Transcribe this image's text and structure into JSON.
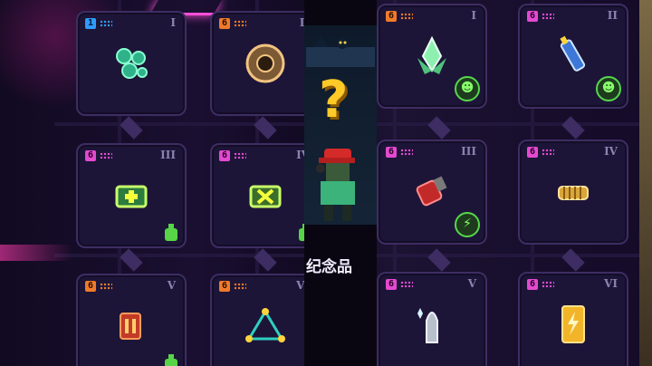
{
  "screen": {
    "label": "纪念品"
  },
  "colors": {
    "accent": "#ff4fd8",
    "badge_green": "#56d64b",
    "panel": "#1d1538"
  },
  "left_cards": [
    {
      "tier": "1",
      "roman": "I",
      "item": "cell-cluster-icon",
      "tier_color": "blue"
    },
    {
      "tier": "6",
      "roman": "II",
      "item": "barrel-icon",
      "tier_color": "orange"
    },
    {
      "tier": "6",
      "roman": "III",
      "item": "medkit-icon",
      "tier_color": "pink"
    },
    {
      "tier": "6",
      "roman": "IV",
      "item": "cross-bag-icon",
      "tier_color": "pink"
    },
    {
      "tier": "6",
      "roman": "V",
      "item": "explosive-vest-icon",
      "tier_color": "orange"
    },
    {
      "tier": "6",
      "roman": "VI",
      "item": "triangle-gadget-icon",
      "tier_color": "orange"
    }
  ],
  "right_cards": [
    {
      "tier": "6",
      "roman": "I",
      "item": "crystal-flower-icon",
      "tier_color": "orange"
    },
    {
      "tier": "6",
      "roman": "II",
      "item": "syringe-icon",
      "tier_color": "pink"
    },
    {
      "tier": "6",
      "roman": "III",
      "item": "red-gauntlet-icon",
      "tier_color": "pink"
    },
    {
      "tier": "6",
      "roman": "IV",
      "item": "coin-stack-icon",
      "tier_color": "pink"
    },
    {
      "tier": "6",
      "roman": "V",
      "item": "bullet-icon",
      "tier_color": "pink"
    },
    {
      "tier": "6",
      "roman": "VI",
      "item": "battery-card-icon",
      "tier_color": "pink"
    }
  ]
}
